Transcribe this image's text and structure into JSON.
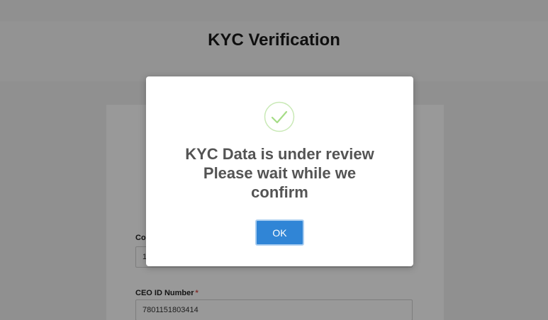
{
  "page": {
    "title": "KYC Verification"
  },
  "form": {
    "company_field": {
      "label_partial": "Co",
      "value_partial": "1"
    },
    "ceo_id": {
      "label": "CEO ID Number",
      "required_mark": "*",
      "value": "7801151803414"
    }
  },
  "modal": {
    "icon": "success-check-icon",
    "title_lines": [
      "KYC Data is under review",
      "Please wait while we",
      "confirm"
    ],
    "ok_label": "OK"
  },
  "colors": {
    "accent": "#3085d6",
    "success": "#a5dc86",
    "required": "#d9534f"
  }
}
